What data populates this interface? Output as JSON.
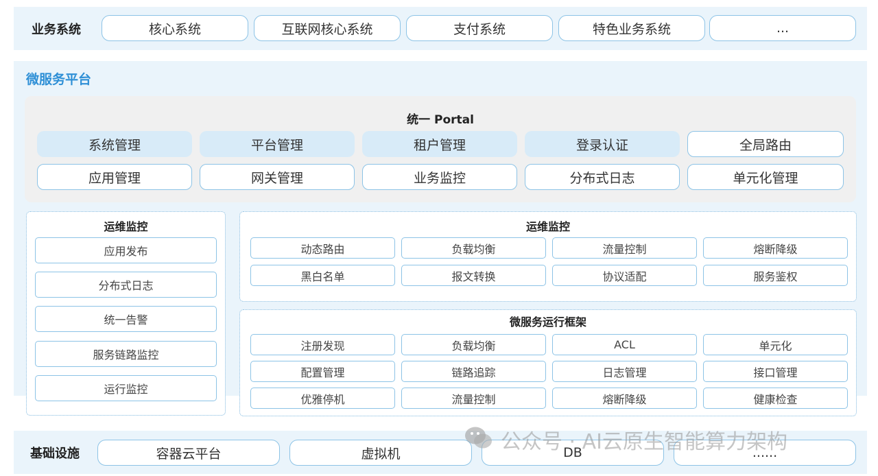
{
  "business": {
    "label": "业务系统",
    "items": [
      "核心系统",
      "互联网核心系统",
      "支付系统",
      "特色业务系统",
      "..."
    ]
  },
  "platform": {
    "title": "微服务平台",
    "portal": {
      "title": "统一 Portal",
      "row1": [
        "系统管理",
        "平台管理",
        "租户管理",
        "登录认证",
        "全局路由"
      ],
      "row2": [
        "应用管理",
        "网关管理",
        "业务监控",
        "分布式日志",
        "单元化管理"
      ]
    },
    "ops_left": {
      "title": "运维监控",
      "items": [
        "应用发布",
        "分布式日志",
        "统一告警",
        "服务链路监控",
        "运行监控"
      ]
    },
    "ops_right": {
      "title": "运维监控",
      "rows": [
        [
          "动态路由",
          "负载均衡",
          "流量控制",
          "熔断降级"
        ],
        [
          "黑白名单",
          "报文转换",
          "协议适配",
          "服务鉴权"
        ]
      ]
    },
    "runtime": {
      "title": "微服务运行框架",
      "rows": [
        [
          "注册发现",
          "负载均衡",
          "ACL",
          "单元化"
        ],
        [
          "配置管理",
          "链路追踪",
          "日志管理",
          "接口管理"
        ],
        [
          "优雅停机",
          "流量控制",
          "熔断降级",
          "健康检查"
        ]
      ]
    }
  },
  "infra": {
    "label": "基础设施",
    "items": [
      "容器云平台",
      "虚拟机",
      "DB",
      "......"
    ]
  },
  "watermark": "公众号 · AI云原生智能算力架构",
  "colors": {
    "accent": "#2e8fd6",
    "border": "#8cc3e6",
    "band": "#eaf4fb",
    "fill": "#d8ebf8"
  }
}
